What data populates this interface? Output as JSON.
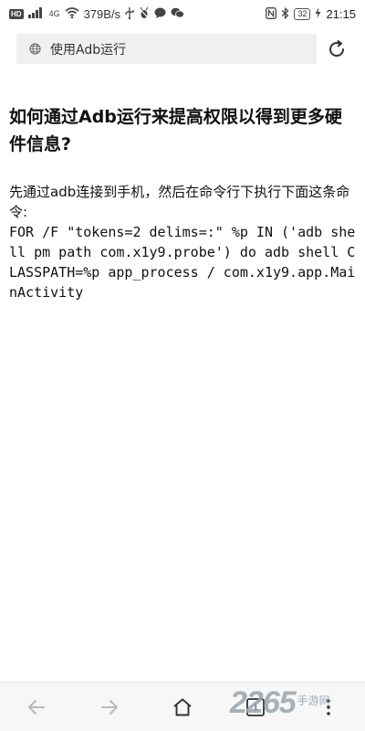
{
  "status_bar": {
    "hd_label": "HD",
    "signal_label": "4G",
    "net_speed": "379B/s",
    "battery_level": "32",
    "time": "21:15",
    "icons": [
      "hd-icon",
      "signal-icon",
      "wifi-icon",
      "usb-icon",
      "debug-icon",
      "chat-icon",
      "wechat-icon",
      "nfc-icon",
      "bluetooth-icon",
      "battery-icon",
      "charging-icon"
    ]
  },
  "address_bar": {
    "url_text": "使用Adb运行",
    "icons": [
      "globe-icon",
      "reload-icon"
    ]
  },
  "article": {
    "headline": "如何通过Adb运行来提高权限以得到更多硬件信息?",
    "intro": "先通过adb连接到手机，然后在命令行下执行下面这条命令:",
    "command": "FOR /F \"tokens=2 delims=:\" %p IN ('adb shell pm path com.x1y9.probe') do adb shell CLASSPATH=%p app_process / com.x1y9.app.MainActivity"
  },
  "nav_bar": {
    "tab_count": "1",
    "icons": [
      "back-icon",
      "forward-icon",
      "home-icon",
      "tabs-icon",
      "more-icon"
    ]
  },
  "watermark": {
    "number": "2265",
    "text": "手游网"
  },
  "colors": {
    "background": "#ffffff",
    "address_bg": "#f0f0f0",
    "nav_bg": "#f7f7f7",
    "text": "#111111",
    "watermark": "#9aa3ad"
  }
}
